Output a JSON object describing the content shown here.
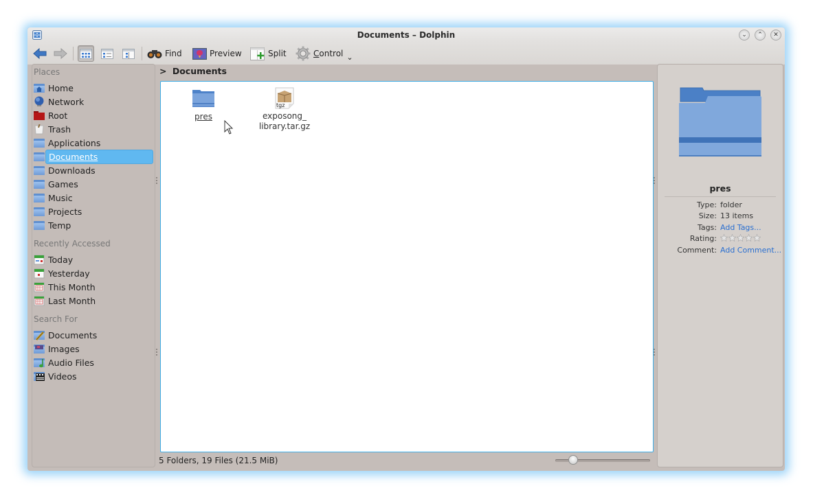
{
  "window": {
    "title": "Documents – Dolphin",
    "controls": [
      {
        "name": "minimize",
        "glyph": "⌄"
      },
      {
        "name": "maximize",
        "glyph": "⌃"
      },
      {
        "name": "close",
        "glyph": "✕"
      }
    ]
  },
  "toolbar": {
    "back_label": "Back",
    "forward_label": "Forward",
    "view_modes": [
      "Icons",
      "Details",
      "Compact"
    ],
    "active_view_mode": "Icons",
    "find_label": "Find",
    "preview_label": "Preview",
    "split_label": "Split",
    "control_label": "Control",
    "control_chevron": "⌄"
  },
  "places": {
    "header": "Places",
    "items": [
      {
        "label": "Home",
        "icon": "home-folder-icon"
      },
      {
        "label": "Network",
        "icon": "network-globe-icon"
      },
      {
        "label": "Root",
        "icon": "root-folder-icon"
      },
      {
        "label": "Trash",
        "icon": "trash-icon"
      },
      {
        "label": "Applications",
        "icon": "folder-icon"
      },
      {
        "label": "Documents",
        "icon": "folder-icon",
        "selected": true
      },
      {
        "label": "Downloads",
        "icon": "folder-icon"
      },
      {
        "label": "Games",
        "icon": "folder-icon"
      },
      {
        "label": "Music",
        "icon": "folder-icon"
      },
      {
        "label": "Projects",
        "icon": "folder-icon"
      },
      {
        "label": "Temp",
        "icon": "folder-icon"
      }
    ],
    "recent_header": "Recently Accessed",
    "recent": [
      {
        "label": "Today",
        "icon": "calendar-today-icon"
      },
      {
        "label": "Yesterday",
        "icon": "calendar-yesterday-icon"
      },
      {
        "label": "This Month",
        "icon": "calendar-month-icon"
      },
      {
        "label": "Last Month",
        "icon": "calendar-month-icon"
      }
    ],
    "search_header": "Search For",
    "search": [
      {
        "label": "Documents",
        "icon": "search-documents-icon"
      },
      {
        "label": "Images",
        "icon": "search-images-icon"
      },
      {
        "label": "Audio Files",
        "icon": "search-audio-icon"
      },
      {
        "label": "Videos",
        "icon": "search-videos-icon"
      }
    ]
  },
  "breadcrumb": {
    "separator": ">",
    "current": "Documents"
  },
  "files": [
    {
      "name": "pres",
      "type": "folder",
      "hovered": true
    },
    {
      "name_line1": "exposong_",
      "name_line2": "library.tar.gz",
      "type": "archive",
      "badge": "tgz"
    }
  ],
  "status": {
    "summary": "5 Folders, 19 Files (21.5 MiB)",
    "zoom_level_fraction": 0.15
  },
  "info_panel": {
    "name": "pres",
    "rows": [
      {
        "label": "Type:",
        "value": "folder"
      },
      {
        "label": "Size:",
        "value": "13 items"
      },
      {
        "label": "Tags:",
        "value": "Add Tags...",
        "link": true
      },
      {
        "label": "Rating:",
        "stars": 5,
        "rated": 0
      },
      {
        "label": "Comment:",
        "value": "Add Comment...",
        "link": true
      }
    ]
  },
  "colors": {
    "accent": "#3daee9",
    "selection": "#60b8f0",
    "link": "#2a6fd0",
    "folder": "#6e9ad6"
  }
}
